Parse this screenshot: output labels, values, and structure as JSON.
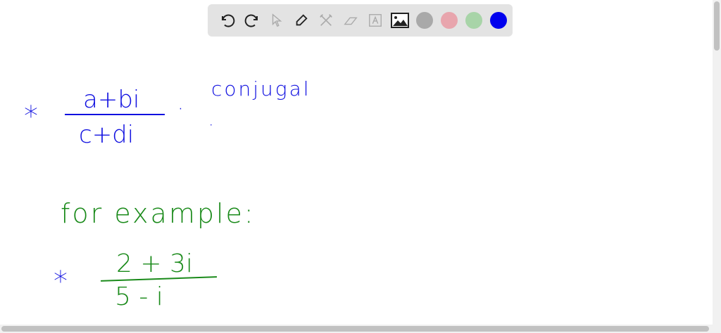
{
  "toolbar": {
    "tools": [
      "undo",
      "redo",
      "select",
      "pen",
      "tools",
      "eraser",
      "text",
      "image"
    ],
    "colors": [
      "#a9a9a9",
      "#e8a5ad",
      "#a8d4a8",
      "#0000ee"
    ]
  },
  "canvas": {
    "bullet1": "*",
    "num1": "a+bi",
    "den1": "c+di",
    "dot": "·",
    "note": "conjugal",
    "example_label": "for example:",
    "bullet2": "*",
    "num2": "2 + 3i",
    "den2": "5 - i"
  }
}
